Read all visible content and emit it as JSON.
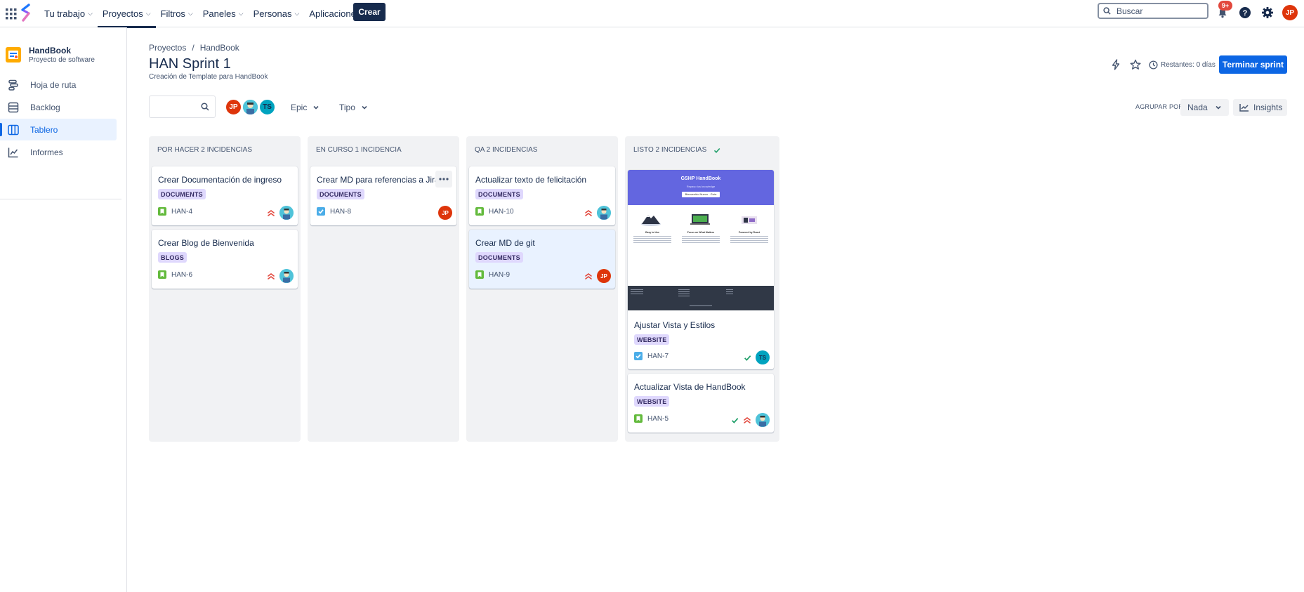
{
  "topnav": {
    "menu": [
      {
        "label": "Tu trabajo"
      },
      {
        "label": "Proyectos"
      },
      {
        "label": "Filtros"
      },
      {
        "label": "Paneles"
      },
      {
        "label": "Personas"
      },
      {
        "label": "Aplicaciones"
      }
    ],
    "create_label": "Crear",
    "search_placeholder": "Buscar",
    "notifications_badge": "9+",
    "user_initials": "JP"
  },
  "sidebar": {
    "project_name": "HandBook",
    "project_type": "Proyecto de software",
    "items": [
      {
        "label": "Hoja de ruta"
      },
      {
        "label": "Backlog"
      },
      {
        "label": "Tablero"
      },
      {
        "label": "Informes"
      }
    ]
  },
  "header": {
    "breadcrumb": [
      "Proyectos",
      "/",
      "HandBook"
    ],
    "title": "HAN Sprint 1",
    "subtitle": "Creación de Template para HandBook",
    "remaining": "Restantes: 0 días",
    "complete_label": "Terminar sprint"
  },
  "filters": {
    "avatars": [
      "JP",
      "",
      "TS"
    ],
    "epic_label": "Epic",
    "type_label": "Tipo",
    "groupby_label": "AGRUPAR POR",
    "groupby_value": "Nada",
    "insights_label": "Insights"
  },
  "columns": [
    {
      "header": "POR HACER 2 INCIDENCIAS",
      "cards": [
        {
          "title": "Crear Documentación de ingreso",
          "label": "DOCUMENTS",
          "key": "HAN-4"
        },
        {
          "title": "Crear Blog de Bienvenida",
          "label": "BLOGS",
          "key": "HAN-6"
        }
      ]
    },
    {
      "header": "EN CURSO 1 INCIDENCIA",
      "cards": [
        {
          "title": "Crear MD para referencias a Jira",
          "label": "DOCUMENTS",
          "key": "HAN-8",
          "assignee": "JP"
        }
      ]
    },
    {
      "header": "QA 2 INCIDENCIAS",
      "cards": [
        {
          "title": "Actualizar texto de felicitación",
          "label": "DOCUMENTS",
          "key": "HAN-10"
        },
        {
          "title": "Crear MD de git",
          "label": "DOCUMENTS",
          "key": "HAN-9",
          "assignee": "JP"
        }
      ]
    },
    {
      "header": "LISTO 2 INCIDENCIAS",
      "cards": [
        {
          "title": "Ajustar Vista y Estilos",
          "label": "WEBSITE",
          "key": "HAN-7",
          "assignee": "TS",
          "cover": {
            "heading": "GSHP HandBook",
            "tagline": "Repaso tus knowledge",
            "button": "Bienvenido Nuevo · Guía",
            "features": [
              "Easy to Use",
              "Focus on What Matters",
              "Powered by React"
            ]
          }
        },
        {
          "title": "Actualizar Vista de HandBook",
          "label": "WEBSITE",
          "key": "HAN-5"
        }
      ]
    }
  ],
  "colors": {
    "primary": "#0c66e4",
    "nav_dark": "#172b4d",
    "label_bg": "#dfd8fd",
    "label_text": "#352c63",
    "story_green": "#63ba3c",
    "task_blue": "#4bade8",
    "priority_red": "#e2483d",
    "avatar_red": "#de350b",
    "avatar_teal": "#00a3bf"
  }
}
